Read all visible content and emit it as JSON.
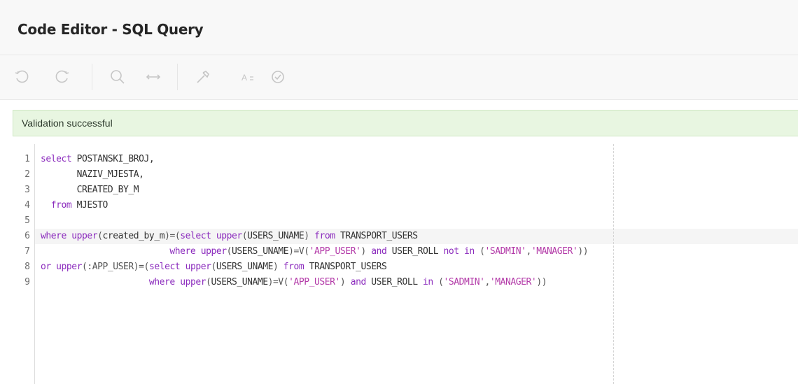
{
  "header": {
    "title": "Code Editor - SQL Query"
  },
  "toolbar": {
    "buttons": [
      {
        "name": "undo",
        "icon": "undo-icon"
      },
      {
        "name": "redo",
        "icon": "redo-icon"
      },
      {
        "name": "find",
        "icon": "search-icon"
      },
      {
        "name": "replace",
        "icon": "arrows-horizontal-icon"
      },
      {
        "name": "query-builder",
        "icon": "hammer-icon"
      },
      {
        "name": "autocomplete",
        "icon": "text-autocomplete-icon"
      },
      {
        "name": "validate",
        "icon": "check-circle-icon"
      }
    ]
  },
  "message": {
    "text": "Validation successful"
  },
  "editor": {
    "line_numbers": [
      "1",
      "2",
      "3",
      "4",
      "5",
      "6",
      "7",
      "8",
      "9"
    ],
    "lines": [
      [
        {
          "t": "select ",
          "c": "kw"
        },
        {
          "t": "POSTANSKI_BROJ,",
          "c": "id"
        }
      ],
      [
        {
          "t": "       NAZIV_MJESTA,",
          "c": "id"
        }
      ],
      [
        {
          "t": "       CREATED_BY_M",
          "c": "id"
        }
      ],
      [
        {
          "t": "  ",
          "c": "id"
        },
        {
          "t": "from ",
          "c": "kw"
        },
        {
          "t": "MJESTO",
          "c": "id"
        }
      ],
      [],
      [
        {
          "t": "where ",
          "c": "kw"
        },
        {
          "t": "upper",
          "c": "fn"
        },
        {
          "t": "(",
          "c": "pl"
        },
        {
          "t": "created_by_m",
          "c": "id"
        },
        {
          "t": ")=(",
          "c": "pl"
        },
        {
          "t": "select ",
          "c": "kw"
        },
        {
          "t": "upper",
          "c": "fn"
        },
        {
          "t": "(",
          "c": "pl"
        },
        {
          "t": "USERS_UNAME",
          "c": "id"
        },
        {
          "t": ") ",
          "c": "pl"
        },
        {
          "t": "from ",
          "c": "kw"
        },
        {
          "t": "TRANSPORT_USERS",
          "c": "id"
        }
      ],
      [
        {
          "t": "                         ",
          "c": "id"
        },
        {
          "t": "where ",
          "c": "kw"
        },
        {
          "t": "upper",
          "c": "fn"
        },
        {
          "t": "(",
          "c": "pl"
        },
        {
          "t": "USERS_UNAME",
          "c": "id"
        },
        {
          "t": ")=V(",
          "c": "pl"
        },
        {
          "t": "'APP_USER'",
          "c": "str"
        },
        {
          "t": ") ",
          "c": "pl"
        },
        {
          "t": "and ",
          "c": "kw"
        },
        {
          "t": "USER_ROLL ",
          "c": "id"
        },
        {
          "t": "not in ",
          "c": "kw"
        },
        {
          "t": "(",
          "c": "pl"
        },
        {
          "t": "'SADMIN'",
          "c": "str"
        },
        {
          "t": ",",
          "c": "pl"
        },
        {
          "t": "'MANAGER'",
          "c": "str"
        },
        {
          "t": "))",
          "c": "pl"
        }
      ],
      [
        {
          "t": "or ",
          "c": "kw"
        },
        {
          "t": "upper",
          "c": "fn"
        },
        {
          "t": "(:APP_USER)=(",
          "c": "pl"
        },
        {
          "t": "select ",
          "c": "kw"
        },
        {
          "t": "upper",
          "c": "fn"
        },
        {
          "t": "(",
          "c": "pl"
        },
        {
          "t": "USERS_UNAME",
          "c": "id"
        },
        {
          "t": ") ",
          "c": "pl"
        },
        {
          "t": "from ",
          "c": "kw"
        },
        {
          "t": "TRANSPORT_USERS",
          "c": "id"
        }
      ],
      [
        {
          "t": "                     ",
          "c": "id"
        },
        {
          "t": "where ",
          "c": "kw"
        },
        {
          "t": "upper",
          "c": "fn"
        },
        {
          "t": "(",
          "c": "pl"
        },
        {
          "t": "USERS_UNAME",
          "c": "id"
        },
        {
          "t": ")=V(",
          "c": "pl"
        },
        {
          "t": "'APP_USER'",
          "c": "str"
        },
        {
          "t": ") ",
          "c": "pl"
        },
        {
          "t": "and ",
          "c": "kw"
        },
        {
          "t": "USER_ROLL ",
          "c": "id"
        },
        {
          "t": "in ",
          "c": "kw"
        },
        {
          "t": "(",
          "c": "pl"
        },
        {
          "t": "'SADMIN'",
          "c": "str"
        },
        {
          "t": ",",
          "c": "pl"
        },
        {
          "t": "'MANAGER'",
          "c": "str"
        },
        {
          "t": "))",
          "c": "pl"
        }
      ]
    ],
    "active_line": 6
  },
  "colors": {
    "keyword": "#8b2bbd",
    "string": "#b33aa8",
    "success_bg": "#e8f6e1"
  }
}
